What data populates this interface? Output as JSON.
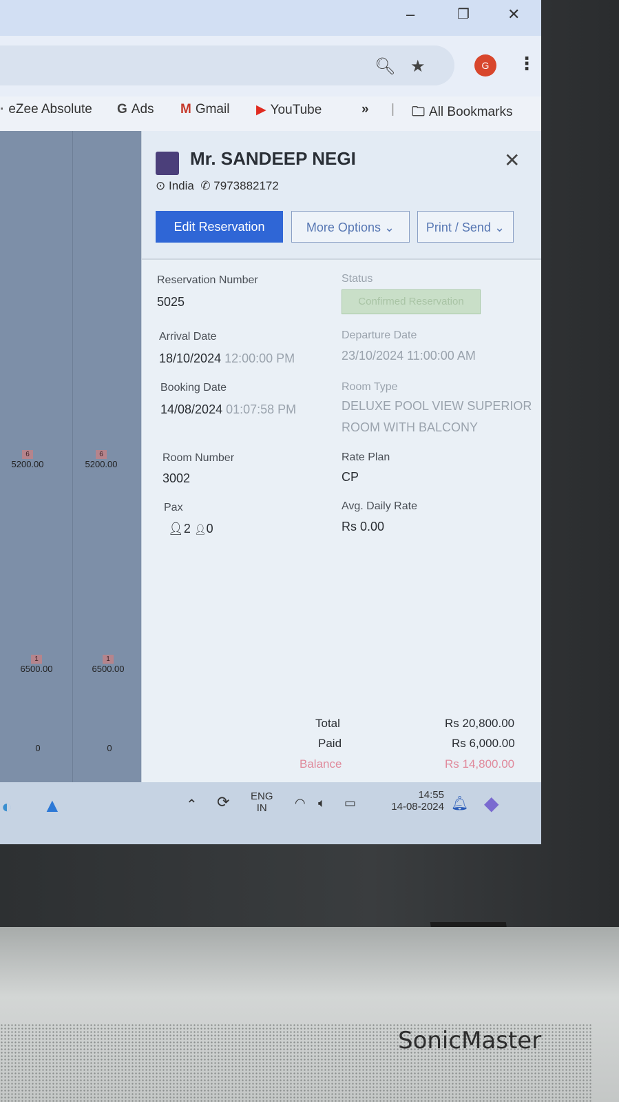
{
  "browser": {
    "profile_initial": "G",
    "bookmarks": [
      {
        "label": "eZee Absolute",
        "icon": "globe-icon"
      },
      {
        "label": "Ads",
        "icon": "google-g-icon"
      },
      {
        "label": "Gmail",
        "icon": "gmail-icon"
      },
      {
        "label": "YouTube",
        "icon": "youtube-icon"
      }
    ],
    "bookmarks_more": "»",
    "all_bookmarks": "All Bookmarks"
  },
  "background": {
    "row1_badge": "6",
    "row1_values": [
      "5200.00",
      "5200.00"
    ],
    "row2_badge": "1",
    "row2_values": [
      "6500.00",
      "6500.00"
    ],
    "row3_values": [
      "0",
      "0"
    ]
  },
  "panel": {
    "guest_name": "Mr. SANDEEP NEGI",
    "country": "India",
    "phone": "7973882172",
    "buttons": {
      "edit": "Edit Reservation",
      "more": "More Options",
      "print": "Print / Send"
    },
    "fields": {
      "reservation_number_label": "Reservation Number",
      "reservation_number": "5025",
      "status_label": "Status",
      "status": "Confirmed Reservation",
      "arrival_label": "Arrival Date",
      "arrival_date": "18/10/2024",
      "arrival_time": "12:00:00 PM",
      "departure_label": "Departure Date",
      "departure": "23/10/2024 11:00:00 AM",
      "booking_label": "Booking Date",
      "booking_date": "14/08/2024",
      "booking_time": "01:07:58 PM",
      "room_type_label": "Room Type",
      "room_type_line1": "DELUXE POOL VIEW SUPERIOR",
      "room_type_line2": "ROOM WITH BALCONY",
      "room_number_label": "Room Number",
      "room_number": "3002",
      "rate_plan_label": "Rate Plan",
      "rate_plan": "CP",
      "pax_label": "Pax",
      "pax_adults": "2",
      "pax_children": "0",
      "avg_rate_label": "Avg. Daily Rate",
      "avg_rate": "Rs 0.00"
    },
    "totals": {
      "total_label": "Total",
      "total": "Rs 20,800.00",
      "paid_label": "Paid",
      "paid": "Rs 6,000.00",
      "balance_label": "Balance",
      "balance": "Rs 14,800.00"
    }
  },
  "taskbar": {
    "lang_line1": "ENG",
    "lang_line2": "IN",
    "time": "14:55",
    "date": "14-08-2024"
  },
  "laptop": {
    "brand": "SonicMaster"
  }
}
